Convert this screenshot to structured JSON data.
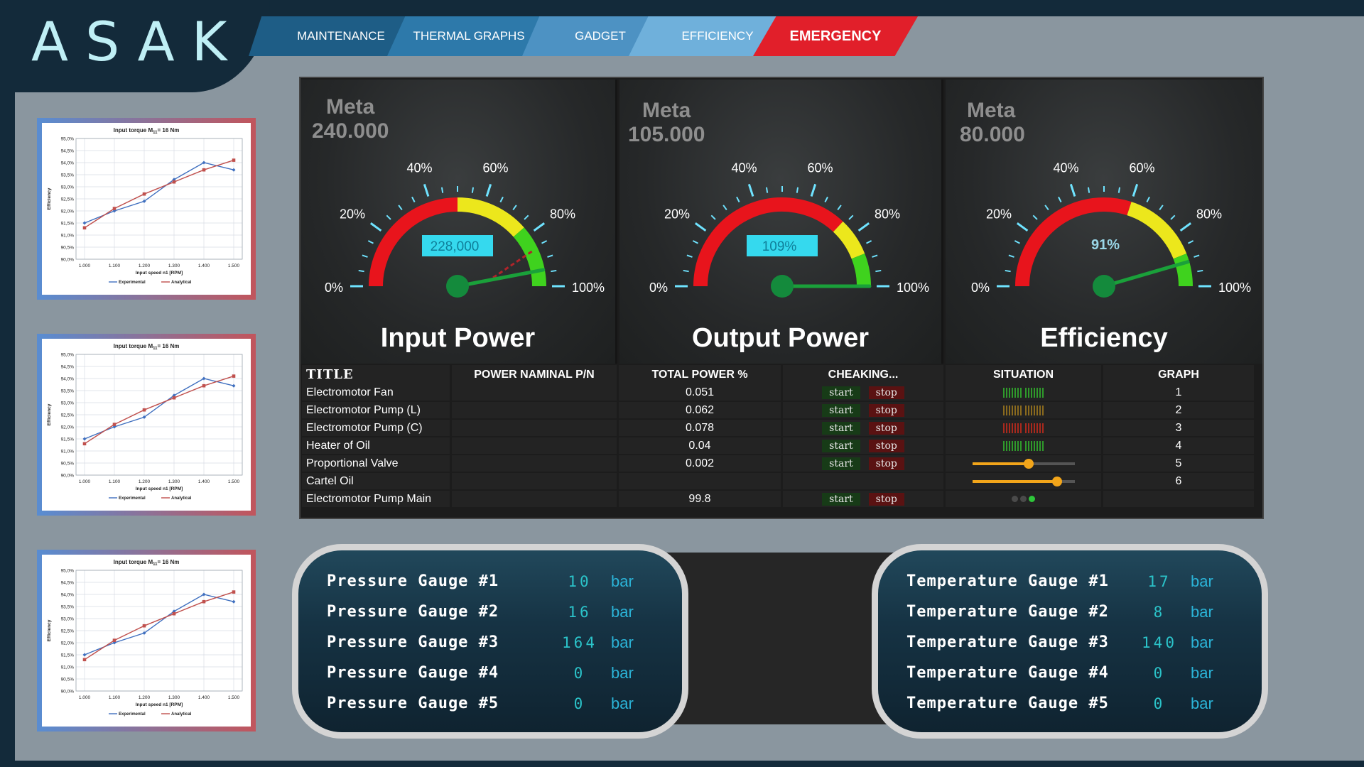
{
  "app": {
    "logo": "ASAK"
  },
  "tabs": {
    "maintenance": "MAINTENANCE",
    "thermal": "THERMAL GRAPHS",
    "gadget": "GADGET",
    "efficiency": "EFFICIENCY",
    "emergency": "EMERGENCY"
  },
  "thumbnails": {
    "title": "Input torque M",
    "title_sub": "11",
    "title_rest": "= 16 Nm",
    "ylabel": "Efficiency",
    "xlabel": "Input speed n1 [RPM]",
    "legend_experimental": "Experimental",
    "legend_analytical": "Analytical"
  },
  "chart_data": [
    {
      "type": "line",
      "title": "Input torque M11 = 16 Nm",
      "xlabel": "Input speed n1 [RPM]",
      "ylabel": "Efficiency",
      "x": [
        1000,
        1100,
        1200,
        1300,
        1400,
        1500
      ],
      "x_ticks": [
        "1.000",
        "1.100",
        "1.200",
        "1.300",
        "1.400",
        "1.500"
      ],
      "y_ticks": [
        "90,0%",
        "90,5%",
        "91,0%",
        "91,5%",
        "92,0%",
        "92,5%",
        "93,0%",
        "93,5%",
        "94,0%",
        "94,5%",
        "95,0%"
      ],
      "ylim": [
        90.0,
        95.0
      ],
      "series": [
        {
          "name": "Experimental",
          "color": "#3f6fbf",
          "values": [
            91.5,
            92.0,
            92.4,
            93.3,
            94.0,
            93.7
          ]
        },
        {
          "name": "Analytical",
          "color": "#c0504d",
          "values": [
            91.3,
            92.1,
            92.7,
            93.2,
            93.7,
            94.1
          ]
        }
      ],
      "legend": "bottom"
    },
    {
      "type": "line",
      "title": "Input torque M11 = 16 Nm",
      "xlabel": "Input speed n1 [RPM]",
      "ylabel": "Efficiency",
      "x": [
        1000,
        1100,
        1200,
        1300,
        1400,
        1500
      ],
      "x_ticks": [
        "1.000",
        "1.100",
        "1.200",
        "1.300",
        "1.400",
        "1.500"
      ],
      "y_ticks": [
        "90,0%",
        "90,5%",
        "91,0%",
        "91,5%",
        "92,0%",
        "92,5%",
        "93,0%",
        "93,5%",
        "94,0%",
        "94,5%",
        "95,0%"
      ],
      "ylim": [
        90.0,
        95.0
      ],
      "series": [
        {
          "name": "Experimental",
          "color": "#3f6fbf",
          "values": [
            91.5,
            92.0,
            92.4,
            93.3,
            94.0,
            93.7
          ]
        },
        {
          "name": "Analytical",
          "color": "#c0504d",
          "values": [
            91.3,
            92.1,
            92.7,
            93.2,
            93.7,
            94.1
          ]
        }
      ],
      "legend": "bottom"
    },
    {
      "type": "line",
      "title": "Input torque M11 = 16 Nm",
      "xlabel": "Input speed n1 [RPM]",
      "ylabel": "Efficiency",
      "x": [
        1000,
        1100,
        1200,
        1300,
        1400,
        1500
      ],
      "x_ticks": [
        "1.000",
        "1.100",
        "1.200",
        "1.300",
        "1.400",
        "1.500"
      ],
      "y_ticks": [
        "90,0%",
        "90,5%",
        "91,0%",
        "91,5%",
        "92,0%",
        "92,5%",
        "93,0%",
        "93,5%",
        "94,0%",
        "94,5%",
        "95,0%"
      ],
      "ylim": [
        90.0,
        95.0
      ],
      "series": [
        {
          "name": "Experimental",
          "color": "#3f6fbf",
          "values": [
            91.5,
            92.0,
            92.4,
            93.3,
            94.0,
            93.7
          ]
        },
        {
          "name": "Analytical",
          "color": "#c0504d",
          "values": [
            91.3,
            92.1,
            92.7,
            93.2,
            93.7,
            94.1
          ]
        }
      ],
      "legend": "bottom"
    }
  ],
  "gauges": [
    {
      "meta_label": "Meta",
      "meta_value": "240.000",
      "title": "Input Power",
      "readout": "228,000",
      "readout_style": "box",
      "needle_percent": 94,
      "ghost_needle_percent": 86,
      "zones": [
        {
          "from": 0,
          "to": 50,
          "color": "#e8141c"
        },
        {
          "from": 50,
          "to": 77,
          "color": "#ece71c"
        },
        {
          "from": 77,
          "to": 100,
          "color": "#3fd21e"
        }
      ]
    },
    {
      "meta_label": "Meta",
      "meta_value": "105.000",
      "title": "Output Power",
      "readout": "109%",
      "readout_style": "box",
      "needle_percent": 100,
      "zones": [
        {
          "from": 0,
          "to": 74,
          "color": "#e8141c"
        },
        {
          "from": 74,
          "to": 88,
          "color": "#ece71c"
        },
        {
          "from": 88,
          "to": 100,
          "color": "#3fd21e"
        }
      ]
    },
    {
      "meta_label": "Meta",
      "meta_value": "80.000",
      "title": "Efficiency",
      "readout": "91%",
      "readout_style": "text",
      "needle_percent": 91,
      "zones": [
        {
          "from": 0,
          "to": 60,
          "color": "#e8141c"
        },
        {
          "from": 60,
          "to": 88,
          "color": "#ece71c"
        },
        {
          "from": 88,
          "to": 100,
          "color": "#3fd21e"
        }
      ]
    }
  ],
  "gauge_scale": [
    "0%",
    "20%",
    "40%",
    "60%",
    "80%",
    "100%"
  ],
  "table": {
    "headers": [
      "TITLE",
      "POWER NAMINAL P/N",
      "TOTAL POWER %",
      "CHEAKING...",
      "SITUATION",
      "GRAPH"
    ],
    "start_label": "start",
    "stop_label": "stop",
    "rows": [
      {
        "title": "Electromotor Fan",
        "power_nominal": "",
        "total_power": "0.051",
        "checking": true,
        "situation": "bar",
        "situation_color": "#2f9a2b",
        "graph": "1"
      },
      {
        "title": "Electromotor Pump (L)",
        "power_nominal": "",
        "total_power": "0.062",
        "checking": true,
        "situation": "bar",
        "situation_color": "#8a6a1e",
        "graph": "2"
      },
      {
        "title": "Electromotor Pump (C)",
        "power_nominal": "",
        "total_power": "0.078",
        "checking": true,
        "situation": "bar",
        "situation_color": "#a9291d",
        "graph": "3"
      },
      {
        "title": "Heater of Oil",
        "power_nominal": "",
        "total_power": "0.04",
        "checking": true,
        "situation": "bar",
        "situation_color": "#2f9a2b",
        "graph": "4"
      },
      {
        "title": "Proportional Valve",
        "power_nominal": "",
        "total_power": "0.002",
        "checking": true,
        "situation": "slider",
        "slider_fraction": 0.55,
        "graph": "5"
      },
      {
        "title": "Cartel Oil",
        "power_nominal": "",
        "total_power": "",
        "checking": false,
        "situation": "slider",
        "slider_fraction": 0.83,
        "graph": "6"
      },
      {
        "title": "Electromotor Pump  Main",
        "power_nominal": "",
        "total_power": "99.8",
        "checking": true,
        "situation": "dots",
        "dots_on": 1,
        "graph": ""
      }
    ]
  },
  "pressure_gauges": [
    {
      "name": "Pressure Gauge #1",
      "value": "10",
      "unit": "bar"
    },
    {
      "name": "Pressure Gauge #2",
      "value": "16",
      "unit": "bar"
    },
    {
      "name": "Pressure Gauge #3",
      "value": "164",
      "unit": "bar"
    },
    {
      "name": "Pressure Gauge #4",
      "value": "0",
      "unit": "bar"
    },
    {
      "name": "Pressure Gauge #5",
      "value": "0",
      "unit": "bar"
    }
  ],
  "temperature_gauges": [
    {
      "name": "Temperature Gauge #1",
      "value": "17",
      "unit": "bar"
    },
    {
      "name": "Temperature Gauge #2",
      "value": "8",
      "unit": "bar"
    },
    {
      "name": "Temperature Gauge #3",
      "value": "140",
      "unit": "bar"
    },
    {
      "name": "Temperature Gauge #4",
      "value": "0",
      "unit": "bar"
    },
    {
      "name": "Temperature Gauge #5",
      "value": "0",
      "unit": "bar"
    }
  ]
}
